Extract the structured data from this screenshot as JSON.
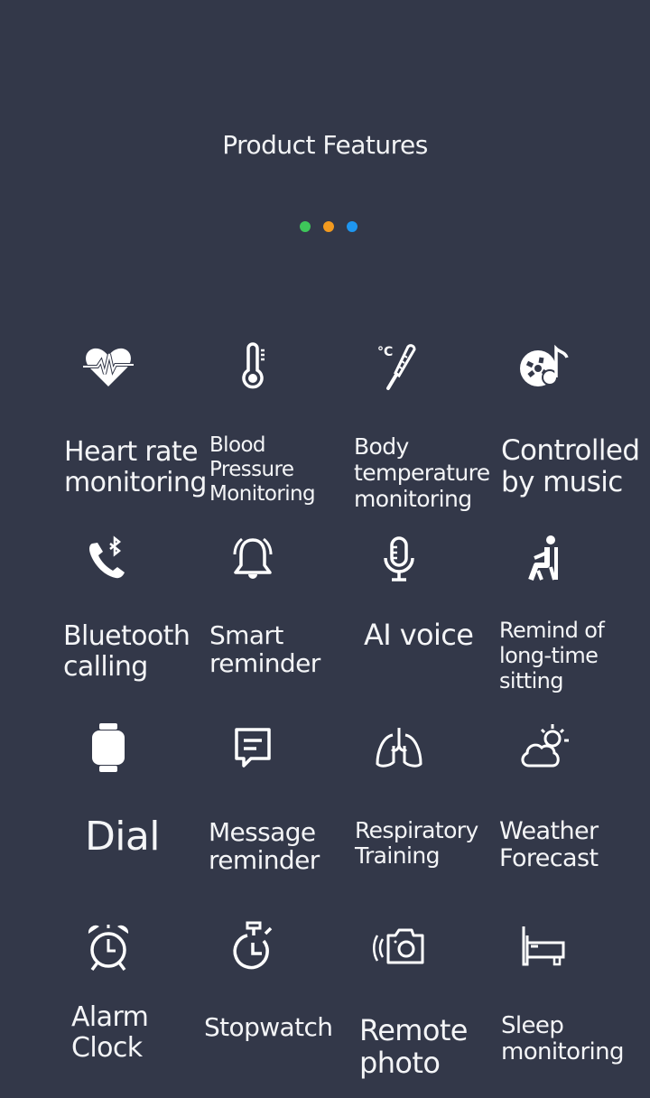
{
  "header": {
    "title": "Product Features",
    "dots": [
      "#3ec75a",
      "#f29a1f",
      "#1e96f0"
    ]
  },
  "features": [
    {
      "icon": "heart-rate-icon",
      "lines": [
        "Heart rate",
        "monitoring"
      ]
    },
    {
      "icon": "thermometer-icon",
      "lines": [
        "Blood",
        "Pressure",
        "Monitoring"
      ]
    },
    {
      "icon": "body-temperature-icon",
      "lines": [
        "Body",
        "temperature",
        "monitoring"
      ]
    },
    {
      "icon": "music-disc-icon",
      "lines": [
        "Controlled",
        "by music"
      ]
    },
    {
      "icon": "bluetooth-call-icon",
      "lines": [
        "Bluetooth",
        "calling"
      ]
    },
    {
      "icon": "bell-icon",
      "lines": [
        "Smart",
        "reminder"
      ]
    },
    {
      "icon": "microphone-icon",
      "lines": [
        "AI voice"
      ]
    },
    {
      "icon": "sitting-person-icon",
      "lines": [
        "Remind of",
        "long-time",
        "sitting"
      ]
    },
    {
      "icon": "watch-icon",
      "lines": [
        "Dial"
      ]
    },
    {
      "icon": "message-icon",
      "lines": [
        "Message",
        "reminder"
      ]
    },
    {
      "icon": "lungs-icon",
      "lines": [
        "Respiratory",
        "Training"
      ]
    },
    {
      "icon": "weather-icon",
      "lines": [
        "Weather",
        "Forecast"
      ]
    },
    {
      "icon": "alarm-clock-icon",
      "lines": [
        "Alarm",
        "Clock"
      ]
    },
    {
      "icon": "stopwatch-icon",
      "lines": [
        "Stopwatch"
      ]
    },
    {
      "icon": "camera-icon",
      "lines": [
        "Remote",
        "photo"
      ]
    },
    {
      "icon": "bed-icon",
      "lines": [
        "Sleep",
        "monitoring"
      ]
    }
  ]
}
